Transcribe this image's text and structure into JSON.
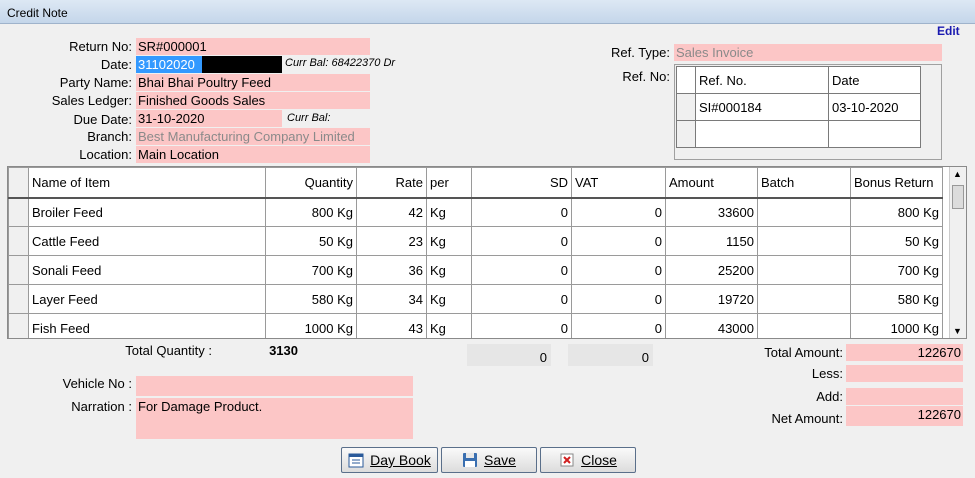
{
  "window": {
    "title": "Credit Note",
    "edit_link": "Edit"
  },
  "form": {
    "return_no": {
      "label": "Return No:",
      "value": "SR#000001"
    },
    "date": {
      "label": "Date:",
      "value": "31102020",
      "curr_bal": "Curr Bal: 68422370 Dr"
    },
    "party_name": {
      "label": "Party Name:",
      "value": "Bhai Bhai Poultry Feed"
    },
    "sales_ledger": {
      "label": "Sales Ledger:",
      "value": "Finished Goods Sales"
    },
    "due_date": {
      "label": "Due Date:",
      "value": "31-10-2020",
      "curr_bal": "Curr Bal:"
    },
    "branch": {
      "label": "Branch:",
      "value": "Best Manufacturing Company Limited"
    },
    "location": {
      "label": "Location:",
      "value": "Main Location"
    },
    "ref_type": {
      "label": "Ref. Type:",
      "value": "Sales Invoice"
    },
    "ref_no_label": "Ref. No:"
  },
  "ref_table": {
    "headers": [
      "Ref. No.",
      "Date"
    ],
    "rows": [
      [
        "SI#000184",
        "03-10-2020"
      ],
      [
        "",
        ""
      ]
    ]
  },
  "grid": {
    "headers": [
      "Name of Item",
      "Quantity",
      "Rate",
      "per",
      "SD",
      "VAT",
      "Amount",
      "Batch",
      "Bonus Return"
    ],
    "rows": [
      [
        "Broiler Feed",
        "800 Kg",
        "42",
        "Kg",
        "0",
        "0",
        "33600",
        "",
        "800 Kg"
      ],
      [
        "Cattle Feed",
        "50 Kg",
        "23",
        "Kg",
        "0",
        "0",
        "1150",
        "",
        "50 Kg"
      ],
      [
        "Sonali Feed",
        "700 Kg",
        "36",
        "Kg",
        "0",
        "0",
        "25200",
        "",
        "700 Kg"
      ],
      [
        "Layer Feed",
        "580 Kg",
        "34",
        "Kg",
        "0",
        "0",
        "19720",
        "",
        "580 Kg"
      ],
      [
        "Fish Feed",
        "1000 Kg",
        "43",
        "Kg",
        "0",
        "0",
        "43000",
        "",
        "1000 Kg"
      ]
    ]
  },
  "totals": {
    "total_quantity_label": "Total Quantity :",
    "total_quantity": "3130",
    "sd_total": "0",
    "vat_total": "0",
    "total_amount_label": "Total Amount:",
    "total_amount": "122670",
    "less_label": "Less:",
    "less": "",
    "add_label": "Add:",
    "add": "",
    "net_amount_label": "Net Amount:",
    "net_amount": "122670"
  },
  "footer": {
    "vehicle_no": {
      "label": "Vehicle No :",
      "value": ""
    },
    "narration": {
      "label": "Narration :",
      "value": "For Damage Product."
    }
  },
  "buttons": {
    "day_book": "Day Book",
    "save": "Save",
    "close": "Close"
  },
  "colors": {
    "field_bg": "#fcc6c6",
    "selection": "#3399ff",
    "link": "#1a1ab0"
  }
}
